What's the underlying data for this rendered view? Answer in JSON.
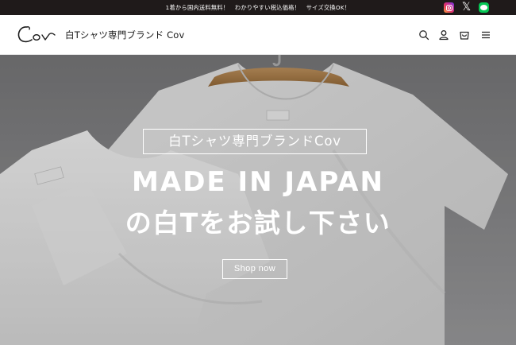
{
  "announcement": {
    "text": "1着から国内送料無料！　わかりやすい税込価格！　サイズ交換OK！"
  },
  "social": {
    "instagram_icon": "instagram-icon",
    "x_icon": "x-twitter-icon",
    "line_icon": "line-icon",
    "x_glyph": "𝕏"
  },
  "header": {
    "logo_text": "Cov",
    "brand_name": "白Tシャツ専門ブランド Cov",
    "icons": [
      "search-icon",
      "account-icon",
      "cart-icon",
      "menu-icon"
    ]
  },
  "hero": {
    "subtitle": "白Tシャツ専門ブランドCov",
    "title_line1": "MADE IN JAPAN",
    "title_line2": "の白Tをお試し下さい",
    "button_label": "Shop now"
  },
  "colors": {
    "announcement_bg": "#1f1a1a",
    "header_bg": "#ffffff",
    "hero_text": "#ffffff",
    "line_green": "#06c755"
  }
}
